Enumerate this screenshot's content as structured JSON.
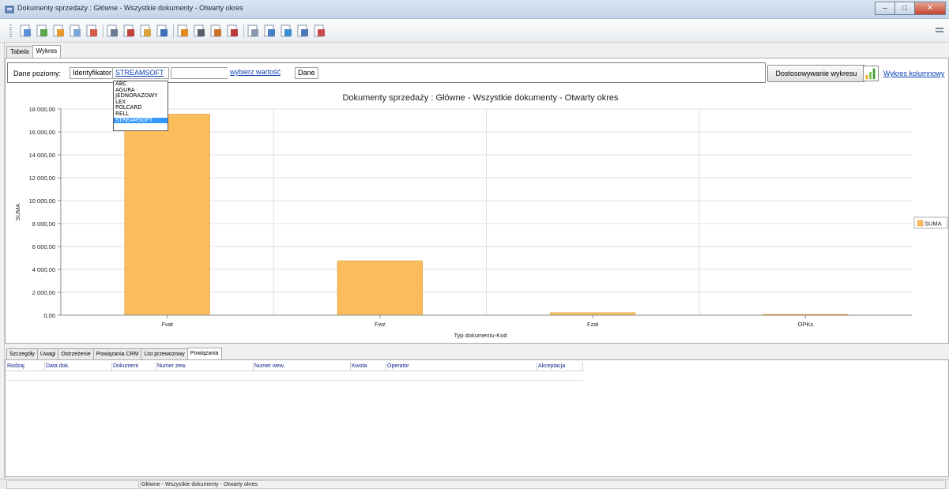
{
  "window": {
    "title": "Dokumenty sprzedaży : Główne - Wszystkie dokumenty - Otwarty okres",
    "controls": [
      "minimize-icon",
      "restore-icon",
      "close-icon"
    ]
  },
  "toolbar": {
    "icons": [
      "new-document-icon",
      "add-document-icon",
      "copy-document-icon",
      "edit-document-icon",
      "delete-document-icon",
      "print-icon",
      "transfer-icon",
      "copy-to-icon",
      "calendar-icon",
      "sort-icon",
      "search-binoculars-icon",
      "filter-icon",
      "clear-filter-icon",
      "lookup-icon",
      "columns-icon",
      "layout-icon",
      "export-icon",
      "grid-settings-icon"
    ],
    "right_icon": "menu-icon"
  },
  "top_tabs": [
    {
      "label": "Tabela",
      "active": false
    },
    {
      "label": "Wykres",
      "active": true
    }
  ],
  "filter": {
    "label": "Dane poziomy:",
    "field_label": "Identyfikator",
    "field_value": "STREAMSOFT",
    "input_value": "",
    "choose_link": "wybierz wartość",
    "done_label": "Dane",
    "customize_button": "Dostosowywanie wykresu",
    "chart_type_link": "Wykres kolumnowy"
  },
  "dropdown": {
    "options": [
      "ABC",
      "AGURA",
      "JEDNORAZOWY",
      "LEX",
      "POLCARD",
      "RELL",
      "STREAMSOFT"
    ],
    "selected": "STREAMSOFT",
    "selected_color": "#3399ff"
  },
  "chart_data": {
    "type": "bar",
    "title": "Dokumenty sprzedaży : Główne - Wszystkie dokumenty - Otwarty okres",
    "xlabel": "Typ dokumentu-Kod",
    "ylabel": "SUMA",
    "categories": [
      "Fvat",
      "Fwz",
      "Fzal",
      "OPKs"
    ],
    "series": [
      {
        "name": "SUMA",
        "values": [
          17550,
          4750,
          220,
          80
        ],
        "color": "#fbbd5c"
      }
    ],
    "ylim": [
      0,
      18000
    ],
    "yticks": [
      "0,00",
      "2 000,00",
      "4 000,00",
      "6 000,00",
      "8 000,00",
      "10 000,00",
      "12 000,00",
      "14 000,00",
      "16 000,00",
      "18 000,00"
    ],
    "grid": true,
    "legend": "right"
  },
  "bottom_tabs": [
    {
      "label": "Szczegóły",
      "active": false
    },
    {
      "label": "Uwagi",
      "active": false
    },
    {
      "label": "Ostrzeżenie",
      "active": false
    },
    {
      "label": "Powiązania CRM",
      "active": false
    },
    {
      "label": "List przewozowy",
      "active": false
    },
    {
      "label": "Powiązania",
      "active": true
    }
  ],
  "grid": {
    "columns": [
      "Rodzaj",
      "Data dok.",
      "Dokument",
      "Numer zew.",
      "Numer wew.",
      "Kwota",
      "Operator",
      "Akceptacja"
    ]
  },
  "status": {
    "text": "Główne - Wszystkie dokumenty - Otwarty okres"
  }
}
